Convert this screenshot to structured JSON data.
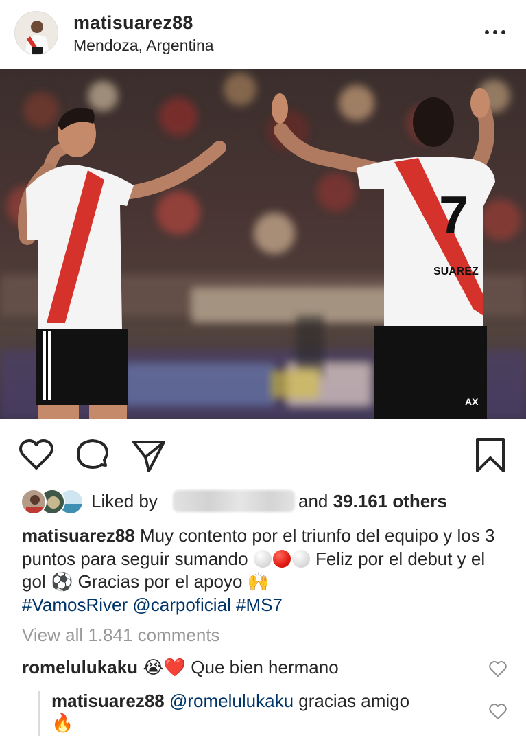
{
  "post": {
    "username": "matisuarez88",
    "location": "Mendoza, Argentina"
  },
  "icons": {
    "more": "more-options-icon",
    "like": "heart-icon",
    "comment": "comment-icon",
    "share": "send-icon",
    "save": "bookmark-icon"
  },
  "likes": {
    "prefix": "Liked by",
    "connector": "and",
    "count": "39.161 others"
  },
  "caption": {
    "username": "matisuarez88",
    "text_1": "Muy contento por el triunfo del equipo y los 3 puntos para seguir sumando",
    "text_2": "Feliz por el debut y el gol",
    "text_3": "Gracias por el apoyo",
    "hashtag_1": "#VamosRiver",
    "mention": "@carpoficial",
    "hashtag_2": "#MS7",
    "emoji_ball": "⚽",
    "emoji_hands": "🙌"
  },
  "view_all_comments": "View all 1.841 comments",
  "comments": [
    {
      "username": "romelulukaku",
      "emojis": "😭❤️",
      "text": "Que bien hermano"
    }
  ],
  "reply": {
    "username": "matisuarez88",
    "mention": "@romelulukaku",
    "text": "gracias amigo",
    "emoji": "🔥"
  },
  "colors": {
    "text": "#262626",
    "link": "#003569",
    "muted": "#999999",
    "river_red": "#d4322a"
  }
}
